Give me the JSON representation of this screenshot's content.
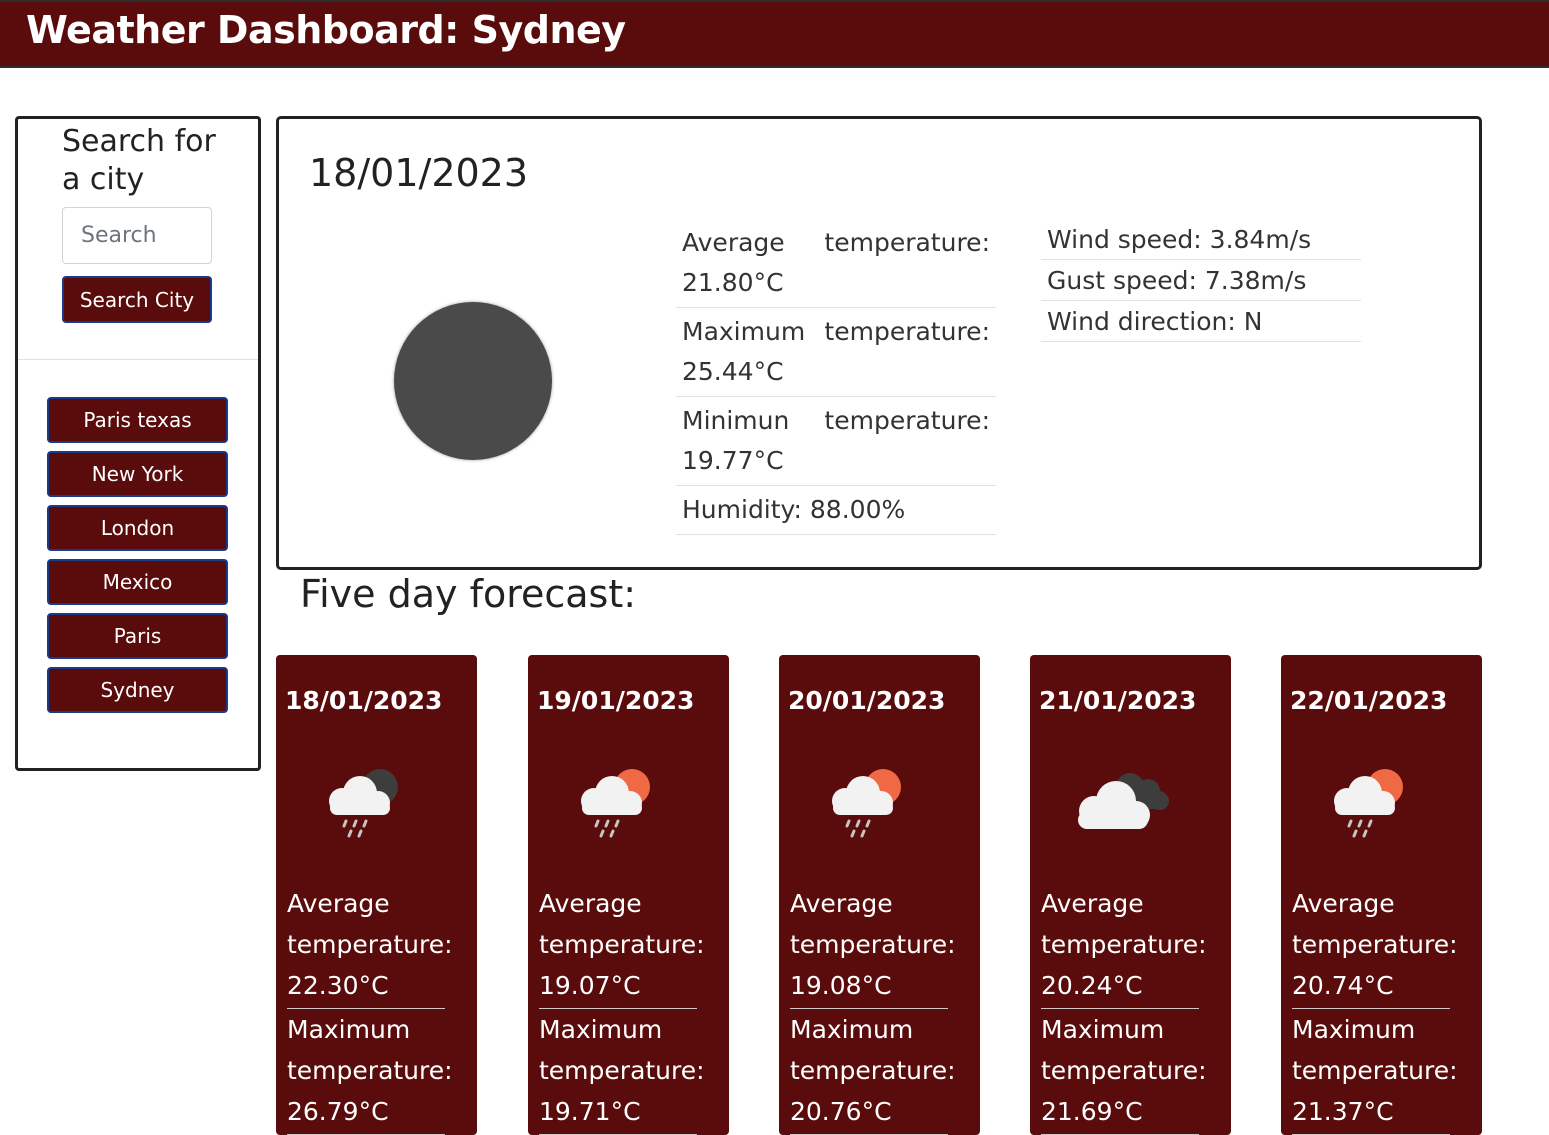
{
  "header": {
    "title": "Weather Dashboard: Sydney"
  },
  "sidebar": {
    "title": "Search for a city",
    "search_placeholder": "Search",
    "search_button": "Search City",
    "history": [
      "Paris texas",
      "New York",
      "London",
      "Mexico",
      "Paris",
      "Sydney"
    ]
  },
  "current": {
    "date": "18/01/2023",
    "avg_label_a": "Average",
    "avg_label_b": "temperature:",
    "avg_value": "21.80°C",
    "max_label_a": "Maximum",
    "max_label_b": "temperature:",
    "max_value": "25.44°C",
    "min_label_a": "Minimun",
    "min_label_b": "temperature:",
    "min_value": "19.77°C",
    "humidity": "Humidity: 88.00%",
    "wind_speed": "Wind speed: 3.84m/s",
    "gust_speed": "Gust speed: 7.38m/s",
    "wind_direction": "Wind direction: N"
  },
  "forecast": {
    "title": "Five day forecast:",
    "days": [
      {
        "date": "18/01/2023",
        "icon": "rain-cloud-night-icon",
        "avg_label": "Average",
        "avg_label2": "temperature:",
        "avg": "22.30°C",
        "max_label": "Maximum",
        "max_label2": "temperature:",
        "max": "26.79°C"
      },
      {
        "date": "19/01/2023",
        "icon": "rain-cloud-sun-icon",
        "avg_label": "Average",
        "avg_label2": "temperature:",
        "avg": "19.07°C",
        "max_label": "Maximum",
        "max_label2": "temperature:",
        "max": "19.71°C"
      },
      {
        "date": "20/01/2023",
        "icon": "rain-cloud-sun-icon",
        "avg_label": "Average",
        "avg_label2": "temperature:",
        "avg": "19.08°C",
        "max_label": "Maximum",
        "max_label2": "temperature:",
        "max": "20.76°C"
      },
      {
        "date": "21/01/2023",
        "icon": "overcast-cloud-icon",
        "avg_label": "Average",
        "avg_label2": "temperature:",
        "avg": "20.24°C",
        "max_label": "Maximum",
        "max_label2": "temperature:",
        "max": "21.69°C"
      },
      {
        "date": "22/01/2023",
        "icon": "rain-cloud-sun-icon",
        "avg_label": "Average",
        "avg_label2": "temperature:",
        "avg": "20.74°C",
        "max_label": "Maximum",
        "max_label2": "temperature:",
        "max": "21.37°C"
      }
    ]
  },
  "colors": {
    "brand": "#5a0b0b",
    "button_border": "#1a3a8a",
    "sun": "#ef6a44",
    "night_cloud": "#3d3d3d"
  }
}
